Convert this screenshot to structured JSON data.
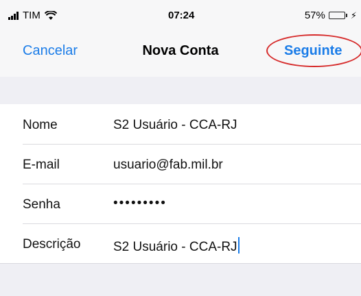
{
  "status_bar": {
    "carrier": "TIM",
    "time": "07:24",
    "battery_percent": "57%",
    "battery_level": 0.57,
    "icons": [
      "signal-icon",
      "wifi-icon",
      "battery-icon",
      "charging-icon"
    ]
  },
  "nav": {
    "cancel_label": "Cancelar",
    "title": "Nova Conta",
    "next_label": "Seguinte"
  },
  "form": {
    "rows": [
      {
        "label": "Nome",
        "value": "S2 Usuário - CCA-RJ"
      },
      {
        "label": "E-mail",
        "value": "usuario@fab.mil.br"
      },
      {
        "label": "Senha",
        "value": "•••••••••"
      },
      {
        "label": "Descrição",
        "value": "S2 Usuário - CCA-RJ"
      }
    ]
  },
  "colors": {
    "accent": "#1a7ce8",
    "annotation": "#d62a2a",
    "background": "#efeff4"
  }
}
